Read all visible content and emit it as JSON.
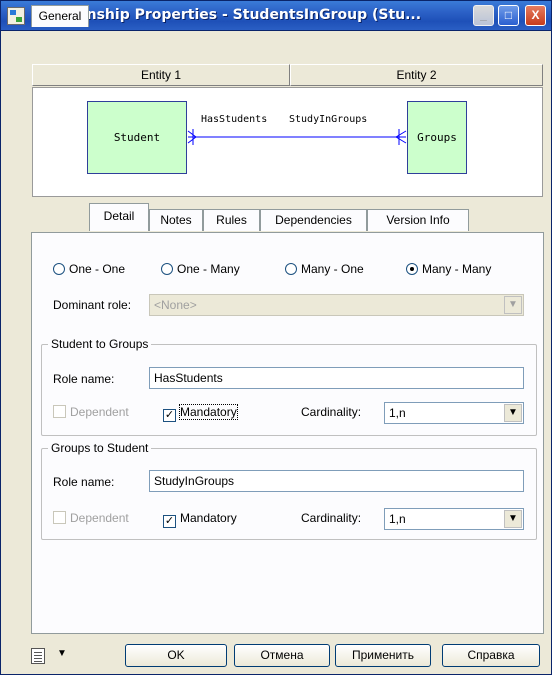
{
  "window": {
    "title": "Relationship Properties - StudentsInGroup (Stu...",
    "min_label": "_",
    "max_label": "□",
    "close_label": "X"
  },
  "entities": {
    "entity1_label": "Entity 1",
    "entity2_label": "Entity 2",
    "left_entity": "Student",
    "right_entity": "Groups",
    "left_role": "HasStudents",
    "right_role": "StudyInGroups"
  },
  "tabs": [
    {
      "label": "General"
    },
    {
      "label": "Detail"
    },
    {
      "label": "Notes"
    },
    {
      "label": "Rules"
    },
    {
      "label": "Dependencies"
    },
    {
      "label": "Version Info"
    }
  ],
  "cardinality_options": [
    {
      "label": "One - One",
      "selected": false
    },
    {
      "label": "One - Many",
      "selected": false
    },
    {
      "label": "Many - One",
      "selected": false
    },
    {
      "label": "Many - Many",
      "selected": true
    }
  ],
  "dominant_role": {
    "label": "Dominant role:",
    "value": "<None>"
  },
  "group1": {
    "title": "Student to Groups",
    "role_label": "Role name:",
    "role_value": "HasStudents",
    "dependent_label": "Dependent",
    "mandatory_label": "Mandatory",
    "mandatory_checked": true,
    "cardinality_label": "Cardinality:",
    "cardinality_value": "1,n"
  },
  "group2": {
    "title": "Groups to Student",
    "role_label": "Role name:",
    "role_value": "StudyInGroups",
    "dependent_label": "Dependent",
    "mandatory_label": "Mandatory",
    "mandatory_checked": true,
    "cardinality_label": "Cardinality:",
    "cardinality_value": "1,n"
  },
  "buttons": {
    "ok": "OK",
    "cancel": "Отмена",
    "apply": "Применить",
    "help": "Справка"
  },
  "colors": {
    "titlebar": "#2d63c8",
    "entity_fill": "#ccffcc",
    "link": "#0000ff"
  }
}
